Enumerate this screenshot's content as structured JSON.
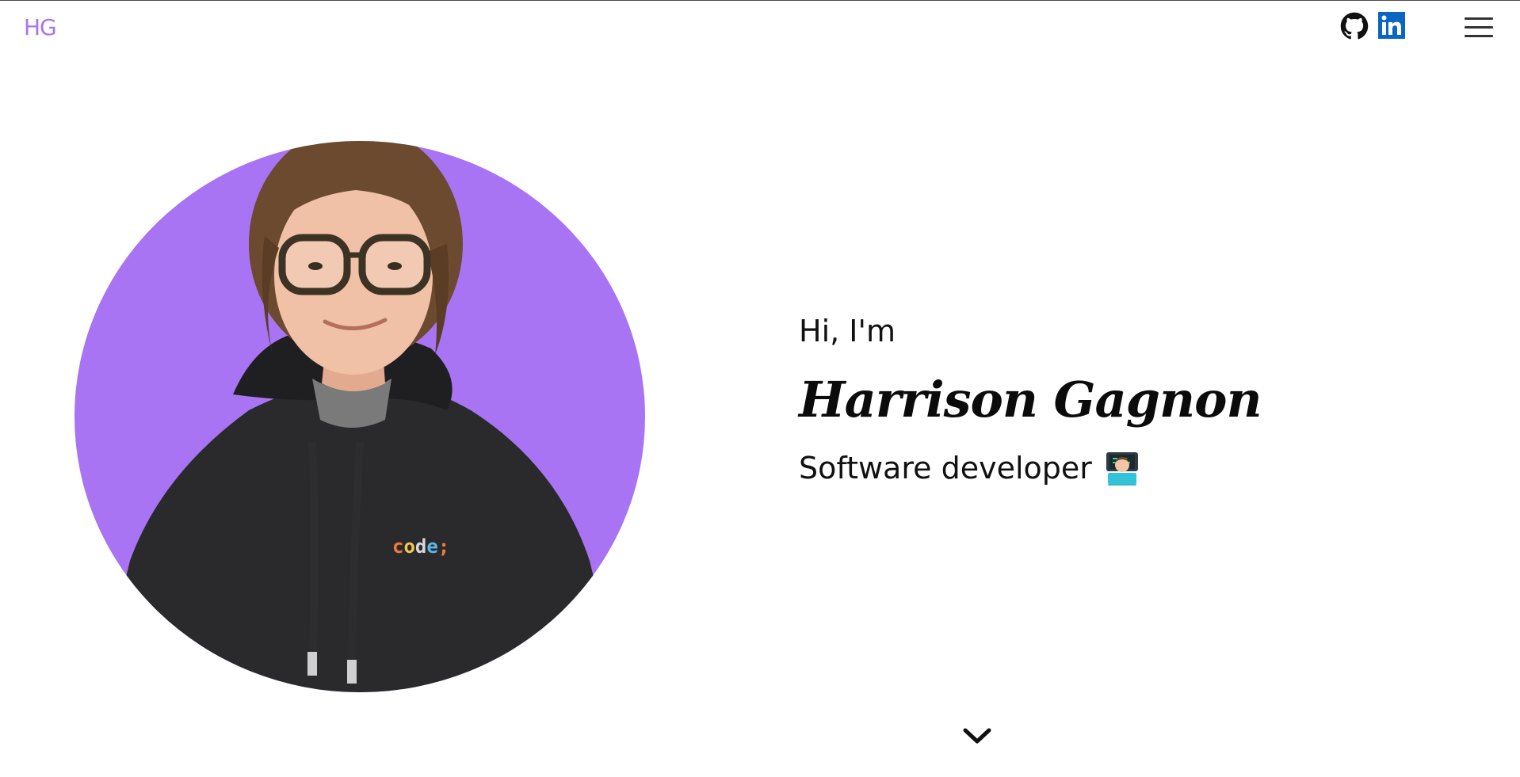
{
  "header": {
    "logo": "HG",
    "social": [
      {
        "name": "GitHub",
        "icon": "github-icon"
      },
      {
        "name": "LinkedIn",
        "icon": "linkedin-icon"
      }
    ],
    "menu_icon": "hamburger-menu-icon"
  },
  "hero": {
    "greeting": "Hi, I'm",
    "name": "Harrison Gagnon",
    "role": "Software developer",
    "role_emoji": "technologist-emoji",
    "photo_background": "#a874f3",
    "hoodie_text": "code;",
    "scroll_icon": "chevron-down-icon"
  },
  "colors": {
    "accent": "#a874f3",
    "linkedin": "#0a66c2",
    "text": "#111111"
  }
}
